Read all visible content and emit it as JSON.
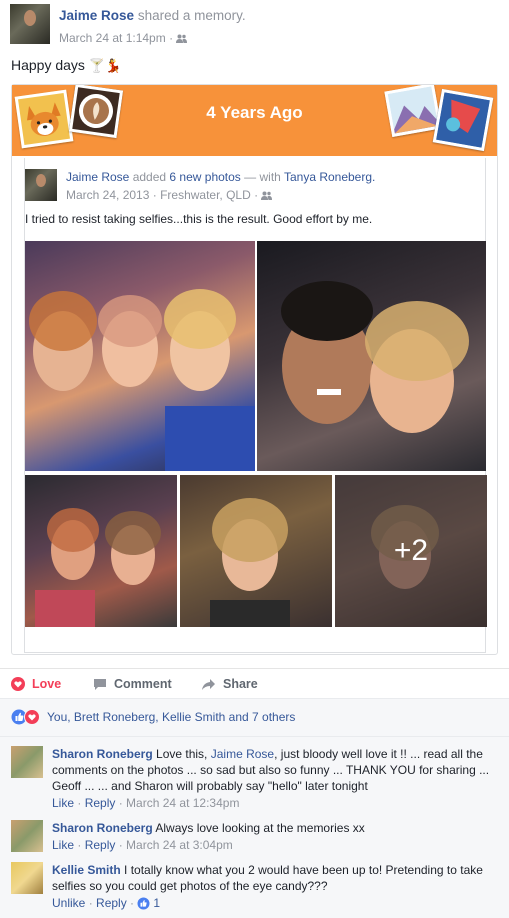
{
  "post": {
    "author": "Jaime Rose",
    "action": "shared a memory.",
    "timestamp": "March 24 at 1:14pm",
    "separator": "·",
    "status_text": "Happy days",
    "status_emoji": "🍸💃",
    "audience_icon": "friends-icon"
  },
  "memory": {
    "banner_title": "4 Years Ago",
    "banner_color": "#f7923a"
  },
  "inner_post": {
    "author": "Jaime Rose",
    "added_text": "added",
    "photos_link": "6 new photos",
    "with_text": "— with",
    "tagged": "Tanya Roneberg.",
    "date": "March 24, 2013",
    "location": "Freshwater, QLD",
    "separator": "·",
    "body": "I tried to resist taking selfies...this is the result. Good effort by me.",
    "more_photos_overlay": "+2"
  },
  "actions": {
    "love": "Love",
    "comment": "Comment",
    "share": "Share",
    "love_color": "#f33e58"
  },
  "reactions": {
    "summary": "You, Brett Roneberg, Kellie Smith and 7 others"
  },
  "comments": [
    {
      "author": "Sharon Roneberg",
      "text_before": "Love this,",
      "mention": "Jaime Rose",
      "text_after": ", just bloody well love it !! ... read all the comments on the photos ... so sad but also so funny ... THANK YOU for sharing ... Geoff ... ... and Sharon will probably say \"hello\" later tonight",
      "like": "Like",
      "reply": "Reply",
      "time": "March 24 at 12:34pm"
    },
    {
      "author": "Sharon Roneberg",
      "text": "Always love looking at the memories xx",
      "like": "Like",
      "reply": "Reply",
      "time": "March 24 at 3:04pm"
    },
    {
      "author": "Kellie Smith",
      "text": "I totally know what you 2 would have been up to! Pretending to take selfies so you could get photos of the eye candy???",
      "unlike": "Unlike",
      "reply": "Reply",
      "like_count": "1"
    }
  ]
}
